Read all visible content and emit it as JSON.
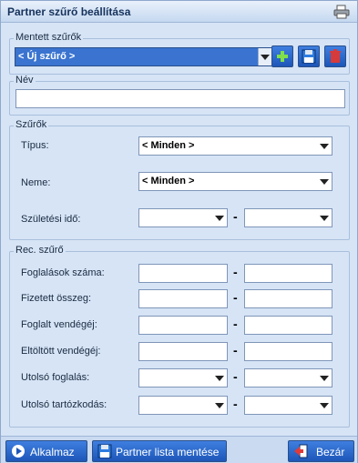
{
  "window": {
    "title": "Partner szűrő beállítása",
    "title_icon": "printer-icon"
  },
  "saved": {
    "legend": "Mentett szűrők",
    "selected": "< Új szűrő >",
    "add_icon": "plus-icon",
    "save_icon": "floppy-icon",
    "delete_icon": "trash-icon"
  },
  "name": {
    "legend": "Név",
    "value": ""
  },
  "filters": {
    "legend": "Szűrők",
    "type_label": "Típus:",
    "type_value": "< Minden >",
    "gender_label": "Neme:",
    "gender_value": "< Minden >",
    "birth_label": "Születési idő:",
    "birth_from": "",
    "birth_to": "",
    "range_separator": "-"
  },
  "rec": {
    "legend": "Rec. szűrő",
    "rows": [
      {
        "label": "Foglalások száma:",
        "kind": "input"
      },
      {
        "label": "Fizetett összeg:",
        "kind": "input"
      },
      {
        "label": "Foglalt vendégéj:",
        "kind": "input"
      },
      {
        "label": "Eltöltött vendégéj:",
        "kind": "input"
      },
      {
        "label": "Utolsó foglalás:",
        "kind": "select"
      },
      {
        "label": "Utolsó tartózkodás:",
        "kind": "select"
      }
    ]
  },
  "footer": {
    "apply_label": "Alkalmaz",
    "apply_icon": "play-icon",
    "save_list_label": "Partner lista mentése",
    "save_list_icon": "floppy-icon",
    "close_label": "Bezár",
    "close_icon": "exit-icon"
  },
  "colors": {
    "accent": "#2a66cc",
    "selection": "#3a74d0",
    "background": "#d6e4f6"
  }
}
